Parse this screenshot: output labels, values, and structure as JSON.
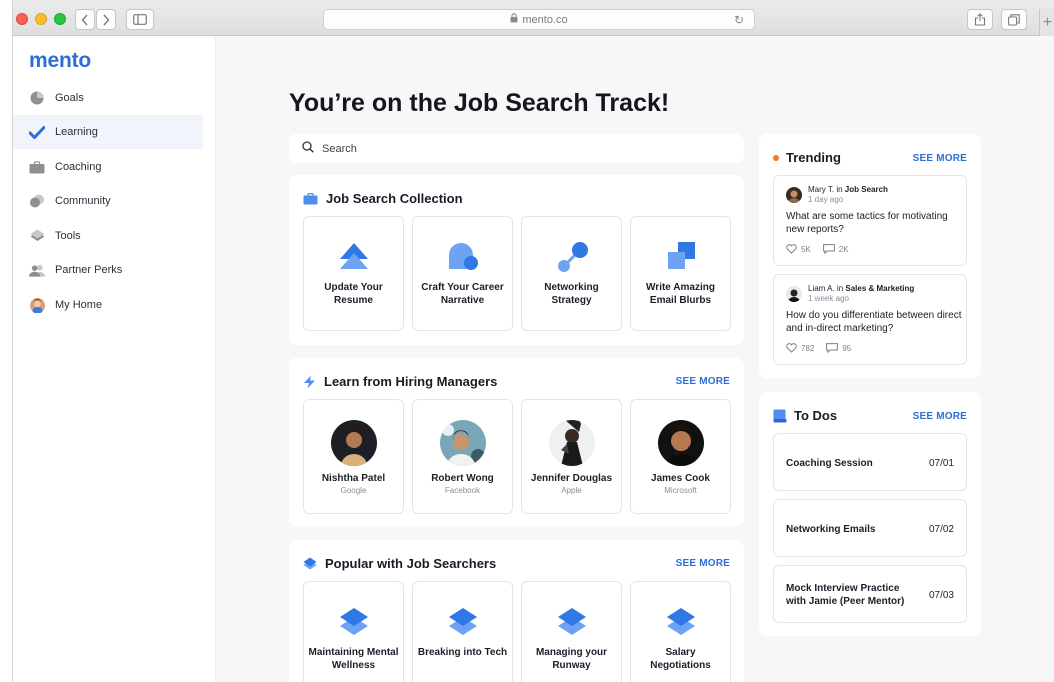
{
  "browser": {
    "url": "mento.co"
  },
  "app": {
    "logo": "mento"
  },
  "sidebar": {
    "items": [
      {
        "label": "Goals",
        "icon": "pie-chart-icon"
      },
      {
        "label": "Learning",
        "icon": "checkmark-icon",
        "active": true
      },
      {
        "label": "Coaching",
        "icon": "briefcase-icon"
      },
      {
        "label": "Community",
        "icon": "overlapping-circles-icon"
      },
      {
        "label": "Tools",
        "icon": "layers-icon"
      },
      {
        "label": "Partner Perks",
        "icon": "people-icon"
      },
      {
        "label": "My Home",
        "icon": "avatar"
      }
    ]
  },
  "main": {
    "title": "You’re on the Job Search Track!",
    "search": {
      "placeholder": "Search"
    },
    "collection": {
      "title": "Job Search Collection",
      "cards": [
        {
          "title": "Update Your Resume"
        },
        {
          "title": "Craft Your Career Narrative"
        },
        {
          "title": "Networking Strategy"
        },
        {
          "title": "Write Amazing Email Blurbs"
        }
      ]
    },
    "hiring_managers": {
      "title": "Learn from Hiring Managers",
      "see_more": "SEE MORE",
      "people": [
        {
          "name": "Nishtha Patel",
          "company": "Google"
        },
        {
          "name": "Robert Wong",
          "company": "Facebook"
        },
        {
          "name": "Jennifer Douglas",
          "company": "Apple"
        },
        {
          "name": "James Cook",
          "company": "Microsoft"
        }
      ]
    },
    "popular": {
      "title": "Popular with Job Searchers",
      "see_more": "SEE MORE",
      "cards": [
        {
          "title": "Maintaining Mental Wellness"
        },
        {
          "title": "Breaking into Tech"
        },
        {
          "title": "Managing your Runway"
        },
        {
          "title": "Salary Negotiations"
        }
      ]
    }
  },
  "trending": {
    "title": "Trending",
    "see_more": "SEE MORE",
    "posts": [
      {
        "author": "Mary T.",
        "in": "in",
        "group": "Job Search",
        "time": "1 day ago",
        "text": "What are some tactics for motivating new reports?",
        "likes": "5K",
        "comments": "2K"
      },
      {
        "author": "Liam A.",
        "in": "in",
        "group": "Sales & Marketing",
        "time": "1 week ago",
        "text": "How do you differentiate between direct and in-direct marketing?",
        "likes": "782",
        "comments": "95"
      }
    ]
  },
  "todos": {
    "title": "To Dos",
    "see_more": "SEE MORE",
    "items": [
      {
        "name": "Coaching Session",
        "date": "07/01"
      },
      {
        "name": "Networking Emails",
        "date": "07/02"
      },
      {
        "name": "Mock Interview Practice with Jamie (Peer Mentor)",
        "date": "07/03"
      }
    ]
  },
  "colors": {
    "accent": "#2b6fd6",
    "icon_blue": "#4f8ef0",
    "trending_dot": "#f07a2b"
  }
}
